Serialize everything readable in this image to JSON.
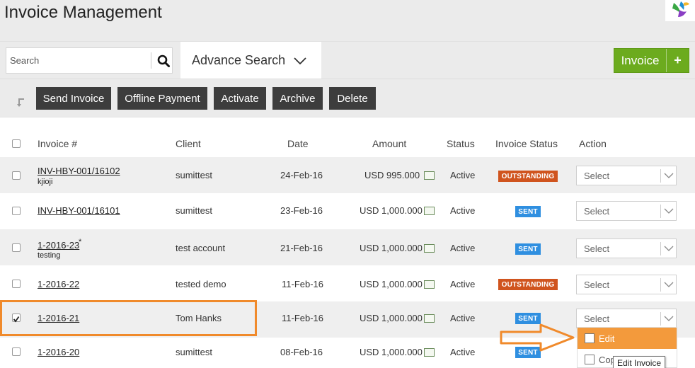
{
  "page": {
    "title": "Invoice Management"
  },
  "search": {
    "placeholder": "Search",
    "advance_label": "Advance Search"
  },
  "invoice_button": {
    "label": "Invoice",
    "plus": "+"
  },
  "actions": {
    "send_invoice": "Send Invoice",
    "offline_payment": "Offline Payment",
    "activate": "Activate",
    "archive": "Archive",
    "delete": "Delete"
  },
  "table": {
    "headers": {
      "invoice": "Invoice #",
      "client": "Client",
      "date": "Date",
      "amount": "Amount",
      "status": "Status",
      "invoice_status": "Invoice Status",
      "action": "Action"
    },
    "select_placeholder": "Select",
    "rows": [
      {
        "invoice": "INV-HBY-001/16102",
        "sub": "kjioji",
        "client": "sumittest",
        "date": "24-Feb-16",
        "amount": "USD 995.000",
        "status": "Active",
        "invoice_status": "OUTSTANDING",
        "checked": false
      },
      {
        "invoice": "INV-HBY-001/16101",
        "sub": "",
        "client": "sumittest",
        "date": "23-Feb-16",
        "amount": "USD 1,000.000",
        "status": "Active",
        "invoice_status": "SENT",
        "checked": false
      },
      {
        "invoice": "1-2016-23",
        "sub": "testing",
        "client": "test account",
        "date": "21-Feb-16",
        "amount": "USD 1,000.000",
        "status": "Active",
        "invoice_status": "SENT",
        "checked": false
      },
      {
        "invoice": "1-2016-22",
        "sub": "",
        "client": "tested demo",
        "date": "11-Feb-16",
        "amount": "USD 1,000.000",
        "status": "Active",
        "invoice_status": "OUTSTANDING",
        "checked": false
      },
      {
        "invoice": "1-2016-21",
        "sub": "",
        "client": "Tom Hanks",
        "date": "11-Feb-16",
        "amount": "USD 1,000.000",
        "status": "Active",
        "invoice_status": "SENT",
        "checked": true
      },
      {
        "invoice": "1-2016-20",
        "sub": "",
        "client": "sumittest",
        "date": "08-Feb-16",
        "amount": "USD 1,000.000",
        "status": "Active",
        "invoice_status": "SENT",
        "checked": false
      }
    ]
  },
  "row_marker": "*",
  "dropdown": {
    "edit": "Edit",
    "copy": "Copy",
    "tooltip": "Edit Invoice"
  },
  "colors": {
    "accent_green": "#6cab1e",
    "outstanding": "#d0541e",
    "sent": "#2f8fe0",
    "highlight": "#f08a2b"
  }
}
